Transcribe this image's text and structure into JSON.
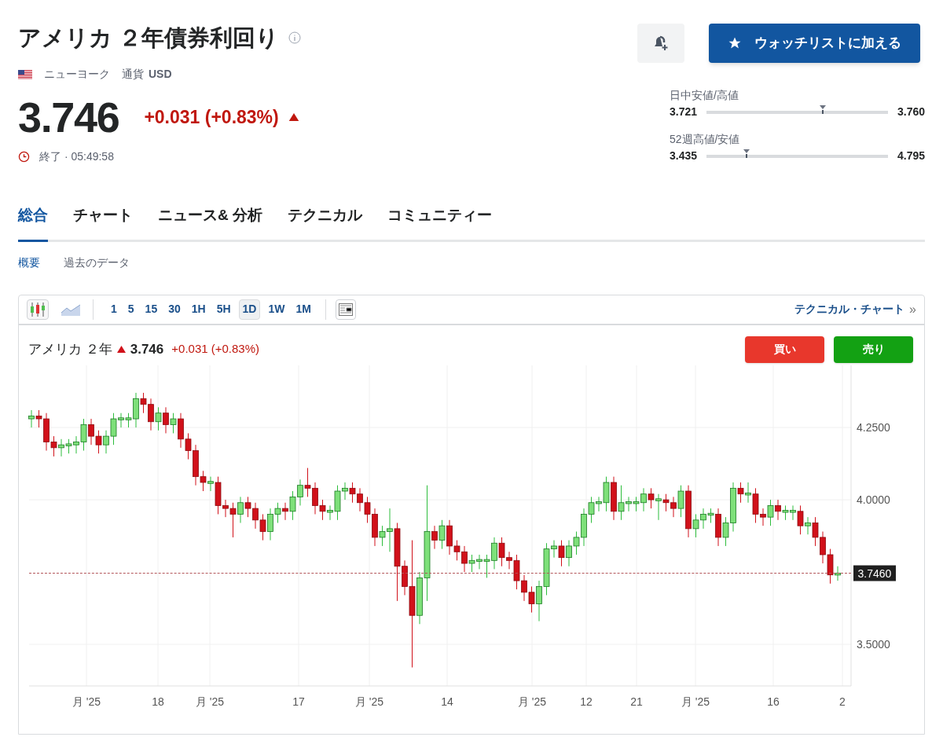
{
  "title": "アメリカ ２年債券利回り",
  "exchange": "ニューヨーク",
  "currency_label": "通貨",
  "currency": "USD",
  "price": "3.746",
  "change": "+0.031 (+0.83%)",
  "rising": true,
  "status": "終了 · 05:49:58",
  "watchlist_button": "ウォッチリストに加える",
  "ranges": [
    {
      "label": "日中安値/高値",
      "low": "3.721",
      "high": "3.760",
      "level": 0.64
    },
    {
      "label": "52週高値/安値",
      "low": "3.435",
      "high": "4.795",
      "level": 0.22
    }
  ],
  "tabs": [
    {
      "label": "総合",
      "selected": true
    },
    {
      "label": "チャート",
      "selected": false
    },
    {
      "label": "ニュース& 分析",
      "selected": false
    },
    {
      "label": "テクニカル",
      "selected": false
    },
    {
      "label": "コミュニティー",
      "selected": false
    }
  ],
  "subtabs": [
    {
      "label": "概要",
      "selected": true
    },
    {
      "label": "過去のデータ",
      "selected": false
    }
  ],
  "chart": {
    "chart_types": [
      {
        "kind": "candles",
        "selected": true
      },
      {
        "kind": "area",
        "selected": false
      }
    ],
    "timeframes": [
      {
        "label": "1",
        "selected": false
      },
      {
        "label": "5",
        "selected": false
      },
      {
        "label": "15",
        "selected": false
      },
      {
        "label": "30",
        "selected": false
      },
      {
        "label": "1H",
        "selected": false
      },
      {
        "label": "5H",
        "selected": false
      },
      {
        "label": "1D",
        "selected": true
      },
      {
        "label": "1W",
        "selected": false
      },
      {
        "label": "1M",
        "selected": false
      }
    ],
    "technical_link": "テクニカル・チャート",
    "link_arrow": "»",
    "symbol": "アメリカ ２年",
    "price": "3.746",
    "change": "+0.031 (+0.83%)",
    "rising": true,
    "buy": "買い",
    "sell": "売り",
    "price_tag": "3.7460",
    "x_labels": [
      "月 '25",
      "18",
      "月 '25",
      "17",
      "月 '25",
      "14",
      "月 '25",
      "12",
      "21",
      "月 '25",
      "16",
      "2"
    ],
    "chart_data": {
      "type": "candlestick",
      "grid": true,
      "ylim": [
        3.356,
        4.465
      ],
      "yticks": [
        {
          "value": 4.25,
          "label": "4.2500"
        },
        {
          "value": 4.0,
          "label": "4.0000"
        },
        {
          "value": 3.5,
          "label": "3.5000"
        }
      ],
      "ohlc": [
        [
          4.28,
          4.31,
          4.25,
          4.29
        ],
        [
          4.29,
          4.31,
          4.25,
          4.28
        ],
        [
          4.28,
          4.3,
          4.17,
          4.2
        ],
        [
          4.2,
          4.22,
          4.15,
          4.18
        ],
        [
          4.18,
          4.21,
          4.15,
          4.19
        ],
        [
          4.19,
          4.21,
          4.16,
          4.19
        ],
        [
          4.19,
          4.22,
          4.16,
          4.2
        ],
        [
          4.2,
          4.28,
          4.17,
          4.26
        ],
        [
          4.26,
          4.28,
          4.19,
          4.22
        ],
        [
          4.22,
          4.24,
          4.16,
          4.19
        ],
        [
          4.19,
          4.24,
          4.16,
          4.22
        ],
        [
          4.22,
          4.3,
          4.19,
          4.28
        ],
        [
          4.28,
          4.3,
          4.25,
          4.28
        ],
        [
          4.28,
          4.3,
          4.25,
          4.28
        ],
        [
          4.28,
          4.37,
          4.25,
          4.35
        ],
        [
          4.35,
          4.37,
          4.3,
          4.33
        ],
        [
          4.33,
          4.35,
          4.24,
          4.27
        ],
        [
          4.27,
          4.32,
          4.24,
          4.3
        ],
        [
          4.3,
          4.32,
          4.23,
          4.26
        ],
        [
          4.26,
          4.3,
          4.23,
          4.28
        ],
        [
          4.28,
          4.3,
          4.18,
          4.21
        ],
        [
          4.21,
          4.23,
          4.14,
          4.17
        ],
        [
          4.17,
          4.19,
          4.05,
          4.08
        ],
        [
          4.08,
          4.1,
          4.03,
          4.06
        ],
        [
          4.06,
          4.08,
          4.03,
          4.06
        ],
        [
          4.06,
          4.08,
          3.95,
          3.98
        ],
        [
          3.98,
          4.0,
          3.94,
          3.97
        ],
        [
          3.97,
          3.99,
          3.87,
          3.95
        ],
        [
          3.95,
          4.01,
          3.92,
          3.99
        ],
        [
          3.99,
          4.01,
          3.94,
          3.97
        ],
        [
          3.97,
          3.99,
          3.9,
          3.93
        ],
        [
          3.93,
          3.95,
          3.86,
          3.89
        ],
        [
          3.89,
          3.97,
          3.86,
          3.95
        ],
        [
          3.95,
          3.99,
          3.92,
          3.97
        ],
        [
          3.97,
          3.99,
          3.93,
          3.96
        ],
        [
          3.96,
          4.03,
          3.93,
          4.01
        ],
        [
          4.01,
          4.07,
          3.98,
          4.05
        ],
        [
          4.05,
          4.11,
          4.01,
          4.04
        ],
        [
          4.04,
          4.06,
          3.95,
          3.98
        ],
        [
          3.98,
          4.0,
          3.93,
          3.96
        ],
        [
          3.96,
          3.98,
          3.93,
          3.96
        ],
        [
          3.96,
          4.05,
          3.93,
          4.03
        ],
        [
          4.03,
          4.06,
          4.0,
          4.04
        ],
        [
          4.04,
          4.06,
          3.99,
          4.02
        ],
        [
          4.02,
          4.04,
          3.96,
          3.99
        ],
        [
          3.99,
          4.01,
          3.92,
          3.95
        ],
        [
          3.95,
          3.97,
          3.84,
          3.87
        ],
        [
          3.87,
          3.91,
          3.84,
          3.89
        ],
        [
          3.89,
          3.97,
          3.82,
          3.9
        ],
        [
          3.9,
          3.92,
          3.65,
          3.77
        ],
        [
          3.77,
          3.79,
          3.67,
          3.7
        ],
        [
          3.7,
          3.86,
          3.42,
          3.6
        ],
        [
          3.6,
          3.75,
          3.57,
          3.73
        ],
        [
          3.73,
          4.05,
          3.65,
          3.89
        ],
        [
          3.89,
          3.91,
          3.83,
          3.86
        ],
        [
          3.86,
          3.93,
          3.83,
          3.91
        ],
        [
          3.91,
          3.93,
          3.81,
          3.84
        ],
        [
          3.84,
          3.86,
          3.79,
          3.82
        ],
        [
          3.82,
          3.84,
          3.75,
          3.78
        ],
        [
          3.78,
          3.81,
          3.75,
          3.79
        ],
        [
          3.79,
          3.81,
          3.76,
          3.79
        ],
        [
          3.79,
          3.81,
          3.73,
          3.79
        ],
        [
          3.79,
          3.87,
          3.76,
          3.85
        ],
        [
          3.85,
          3.87,
          3.77,
          3.8
        ],
        [
          3.8,
          3.82,
          3.76,
          3.79
        ],
        [
          3.79,
          3.81,
          3.69,
          3.72
        ],
        [
          3.72,
          3.74,
          3.65,
          3.68
        ],
        [
          3.68,
          3.7,
          3.61,
          3.64
        ],
        [
          3.64,
          3.72,
          3.58,
          3.7
        ],
        [
          3.7,
          3.85,
          3.67,
          3.83
        ],
        [
          3.83,
          3.86,
          3.8,
          3.84
        ],
        [
          3.84,
          3.86,
          3.77,
          3.8
        ],
        [
          3.8,
          3.86,
          3.77,
          3.84
        ],
        [
          3.84,
          3.89,
          3.81,
          3.87
        ],
        [
          3.87,
          3.97,
          3.84,
          3.95
        ],
        [
          3.95,
          4.01,
          3.92,
          3.99
        ],
        [
          3.99,
          4.01,
          3.96,
          3.99
        ],
        [
          3.99,
          4.08,
          3.96,
          4.06
        ],
        [
          4.06,
          4.08,
          3.93,
          3.96
        ],
        [
          3.96,
          4.05,
          3.93,
          3.99
        ],
        [
          3.99,
          4.01,
          3.96,
          3.99
        ],
        [
          3.99,
          4.01,
          3.96,
          3.99
        ],
        [
          3.99,
          4.04,
          3.96,
          4.02
        ],
        [
          4.02,
          4.04,
          3.97,
          4.0
        ],
        [
          4.0,
          4.02,
          3.93,
          4.0
        ],
        [
          4.0,
          4.02,
          3.96,
          3.99
        ],
        [
          3.99,
          4.01,
          3.94,
          3.97
        ],
        [
          3.97,
          4.05,
          3.94,
          4.03
        ],
        [
          4.03,
          4.05,
          3.87,
          3.9
        ],
        [
          3.9,
          3.95,
          3.87,
          3.93
        ],
        [
          3.93,
          3.97,
          3.9,
          3.95
        ],
        [
          3.95,
          3.97,
          3.92,
          3.95
        ],
        [
          3.95,
          3.97,
          3.84,
          3.87
        ],
        [
          3.87,
          3.94,
          3.84,
          3.92
        ],
        [
          3.92,
          4.06,
          3.89,
          4.04
        ],
        [
          4.04,
          4.06,
          3.99,
          4.02
        ],
        [
          4.02,
          4.06,
          3.99,
          4.02
        ],
        [
          4.02,
          4.04,
          3.92,
          3.95
        ],
        [
          3.95,
          3.97,
          3.91,
          3.94
        ],
        [
          3.94,
          4.0,
          3.91,
          3.98
        ],
        [
          3.98,
          4.0,
          3.93,
          3.96
        ],
        [
          3.96,
          3.98,
          3.93,
          3.96
        ],
        [
          3.96,
          3.98,
          3.93,
          3.96
        ],
        [
          3.96,
          3.98,
          3.88,
          3.91
        ],
        [
          3.91,
          3.94,
          3.88,
          3.92
        ],
        [
          3.92,
          3.94,
          3.84,
          3.87
        ],
        [
          3.87,
          3.89,
          3.78,
          3.81
        ],
        [
          3.81,
          3.83,
          3.71,
          3.74
        ],
        [
          3.74,
          3.77,
          3.72,
          3.746
        ]
      ]
    }
  }
}
